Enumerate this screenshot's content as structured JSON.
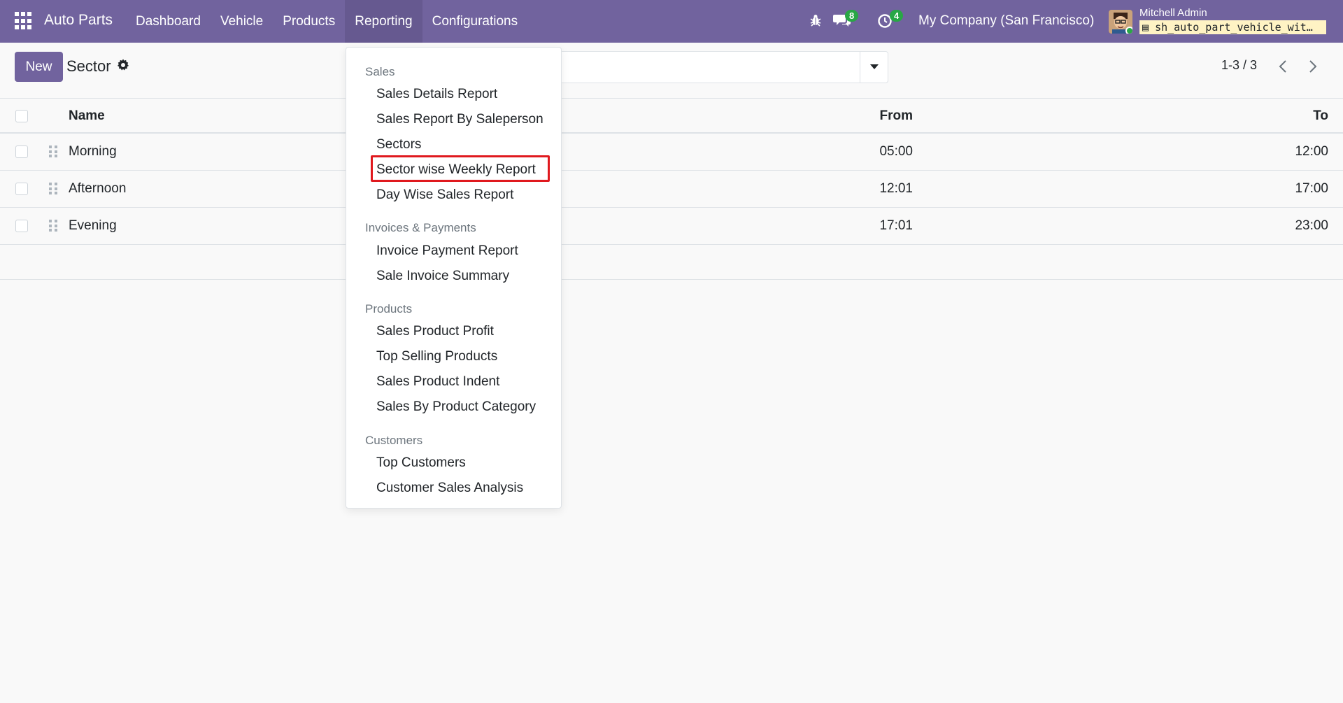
{
  "navbar": {
    "brand": "Auto Parts",
    "menu": [
      {
        "label": "Dashboard"
      },
      {
        "label": "Vehicle"
      },
      {
        "label": "Products"
      },
      {
        "label": "Reporting"
      },
      {
        "label": "Configurations"
      }
    ],
    "messages_count": "8",
    "activities_count": "4",
    "company": "My Company (San Francisco)",
    "user_name": "Mitchell Admin",
    "database": "sh_auto_part_vehicle_wit…"
  },
  "control_panel": {
    "new_label": "New",
    "title": "Sector",
    "pager": "1-3 / 3"
  },
  "table": {
    "columns": {
      "name": "Name",
      "from": "From",
      "to": "To"
    },
    "rows": [
      {
        "name": "Morning",
        "from": "05:00",
        "to": "12:00"
      },
      {
        "name": "Afternoon",
        "from": "12:01",
        "to": "17:00"
      },
      {
        "name": "Evening",
        "from": "17:01",
        "to": "23:00"
      }
    ]
  },
  "reporting_menu": {
    "sections": [
      {
        "header": "Sales",
        "items": [
          "Sales Details Report",
          "Sales Report By Saleperson",
          "Sectors",
          "Sector wise Weekly Report",
          "Day Wise Sales Report"
        ]
      },
      {
        "header": "Invoices & Payments",
        "items": [
          "Invoice Payment Report",
          "Sale Invoice Summary"
        ]
      },
      {
        "header": "Products",
        "items": [
          "Sales Product Profit",
          "Top Selling Products",
          "Sales Product Indent",
          "Sales By Product Category"
        ]
      },
      {
        "header": "Customers",
        "items": [
          "Top Customers",
          "Customer Sales Analysis"
        ]
      }
    ],
    "highlighted_item": "Sector wise Weekly Report",
    "highlight_color": "#e0191e"
  },
  "colors": {
    "brand": "#71639e",
    "badge": "#28a745"
  }
}
